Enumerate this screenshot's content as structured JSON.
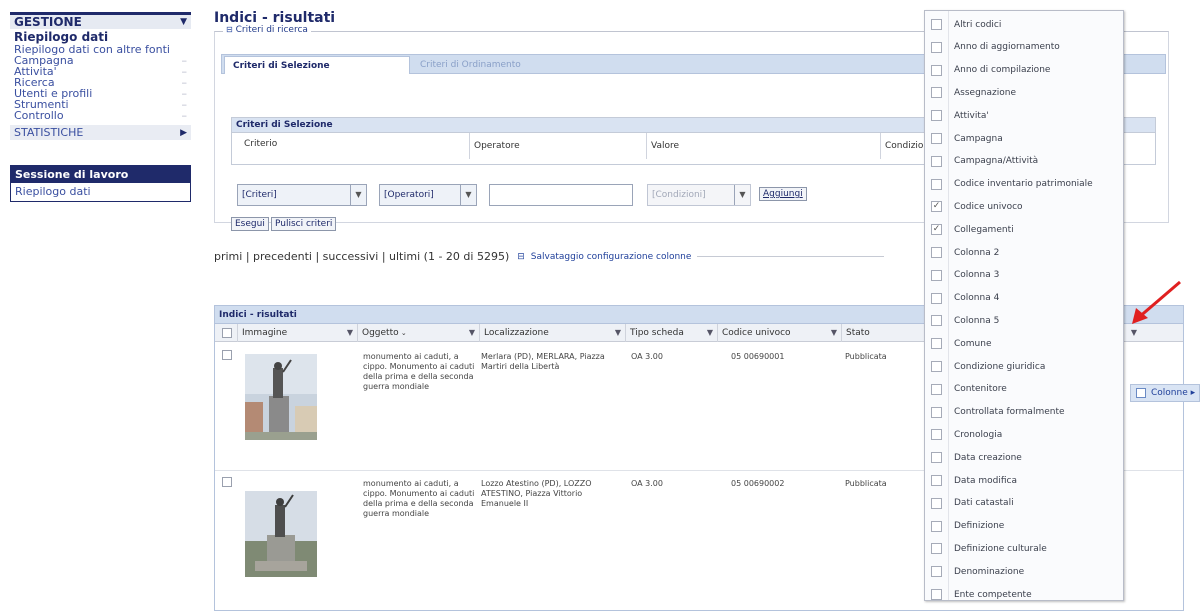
{
  "sidebar": {
    "gestione_title": "GESTIONE",
    "items": [
      {
        "label": "Riepilogo dati",
        "bold": true
      },
      {
        "label": "Riepilogo dati con altre fonti"
      },
      {
        "label": "Campagna"
      },
      {
        "label": "Attivita'"
      },
      {
        "label": "Ricerca"
      },
      {
        "label": "Utenti e profili"
      },
      {
        "label": "Strumenti"
      },
      {
        "label": "Controllo"
      }
    ],
    "statistiche": "STATISTICHE",
    "session_title": "Sessione di lavoro",
    "session_item": "Riepilogo dati"
  },
  "main": {
    "title": "Indici - risultati",
    "criteria_legend": "Criteri di ricerca",
    "tabs": [
      "Criteri di Selezione",
      "Criteri di Ordinamento"
    ],
    "selection_title": "Criteri di Selezione",
    "selection_columns": [
      "Criterio",
      "Operatore",
      "Valore",
      "Condizioni"
    ],
    "combo_criteri": "[Criteri]",
    "combo_operatori": "[Operatori]",
    "combo_condizioni": "[Condizioni]",
    "btn_aggiungi": "Aggiungi",
    "btn_esegui": "Esegui",
    "btn_pulisci": "Pulisci criteri",
    "paging": "primi | precedenti | successivi | ultimi (1 - 20 di 5295)",
    "save_columns": "Salvataggio configurazione colonne"
  },
  "grid": {
    "title": "Indici - risultati",
    "columns": [
      "Immagine",
      "Oggetto",
      "Localizzazione",
      "Tipo scheda",
      "Codice univoco",
      "Stato"
    ],
    "rows": [
      {
        "oggetto": "monumento ai caduti, a cippo. Monumento ai caduti della prima e della seconda guerra mondiale",
        "localizzazione": "Merlara (PD), MERLARA, Piazza Martiri della Libertà",
        "tipo": "OA 3.00",
        "codice": "05 00690001",
        "stato": "Pubblicata"
      },
      {
        "oggetto": "monumento ai caduti, a cippo. Monumento ai caduti della prima e della seconda guerra mondiale",
        "localizzazione": "Lozzo Atestino (PD), LOZZO ATESTINO, Piazza Vittorio Emanuele II",
        "tipo": "OA 3.00",
        "codice": "05 00690002",
        "stato": "Pubblicata"
      }
    ]
  },
  "column_menu": {
    "items": [
      {
        "label": "Altri codici",
        "checked": false
      },
      {
        "label": "Anno di aggiornamento",
        "checked": false
      },
      {
        "label": "Anno di compilazione",
        "checked": false
      },
      {
        "label": "Assegnazione",
        "checked": false
      },
      {
        "label": "Attivita'",
        "checked": false
      },
      {
        "label": "Campagna",
        "checked": false
      },
      {
        "label": "Campagna/Attività",
        "checked": false
      },
      {
        "label": "Codice inventario patrimoniale",
        "checked": false
      },
      {
        "label": "Codice univoco",
        "checked": true
      },
      {
        "label": "Collegamenti",
        "checked": true
      },
      {
        "label": "Colonna 2",
        "checked": false
      },
      {
        "label": "Colonna 3",
        "checked": false
      },
      {
        "label": "Colonna 4",
        "checked": false
      },
      {
        "label": "Colonna 5",
        "checked": false
      },
      {
        "label": "Comune",
        "checked": false
      },
      {
        "label": "Condizione giuridica",
        "checked": false
      },
      {
        "label": "Contenitore",
        "checked": false
      },
      {
        "label": "Controllata formalmente",
        "checked": false
      },
      {
        "label": "Cronologia",
        "checked": false
      },
      {
        "label": "Data creazione",
        "checked": false
      },
      {
        "label": "Data modifica",
        "checked": false
      },
      {
        "label": "Dati catastali",
        "checked": false
      },
      {
        "label": "Definizione",
        "checked": false
      },
      {
        "label": "Definizione culturale",
        "checked": false
      },
      {
        "label": "Denominazione",
        "checked": false
      },
      {
        "label": "Ente competente",
        "checked": false
      }
    ],
    "submenu_label": "Colonne",
    "accent": "#e02020"
  }
}
